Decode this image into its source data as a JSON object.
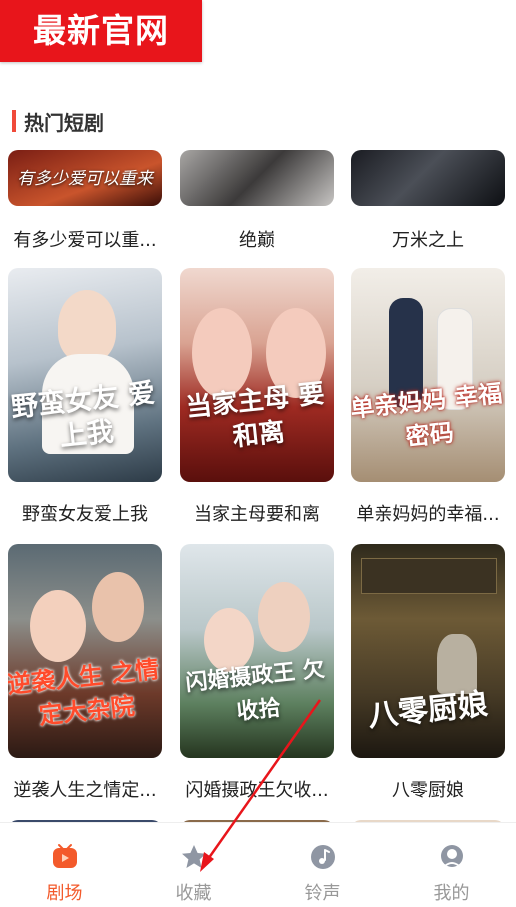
{
  "banner": {
    "text": "最新官网"
  },
  "section": {
    "title": "热门短剧"
  },
  "dramas": [
    {
      "title": "有多少爱可以重...",
      "poster_text": "有多少爱可以重来"
    },
    {
      "title": "绝巅",
      "poster_text": ""
    },
    {
      "title": "万米之上",
      "poster_text": ""
    },
    {
      "title": "野蛮女友爱上我",
      "poster_text": "野蛮女友 爱上我"
    },
    {
      "title": "当家主母要和离",
      "poster_text": "当家主母 要和离"
    },
    {
      "title": "单亲妈妈的幸福...",
      "poster_text": "单亲妈妈 幸福密码"
    },
    {
      "title": "逆袭人生之情定...",
      "poster_text": "逆袭人生 之情定大杂院"
    },
    {
      "title": "闪婚摄政王欠收...",
      "poster_text": "闪婚摄政王 欠收拾"
    },
    {
      "title": "八零厨娘",
      "poster_text": "八零厨娘"
    }
  ],
  "tabs": [
    {
      "label": "剧场",
      "icon": "theater-icon",
      "active": true
    },
    {
      "label": "收藏",
      "icon": "star-icon",
      "active": false
    },
    {
      "label": "铃声",
      "icon": "music-icon",
      "active": false
    },
    {
      "label": "我的",
      "icon": "profile-icon",
      "active": false
    }
  ],
  "colors": {
    "accent": "#f35a2b",
    "banner": "#e8151b",
    "inactive": "#999999"
  }
}
